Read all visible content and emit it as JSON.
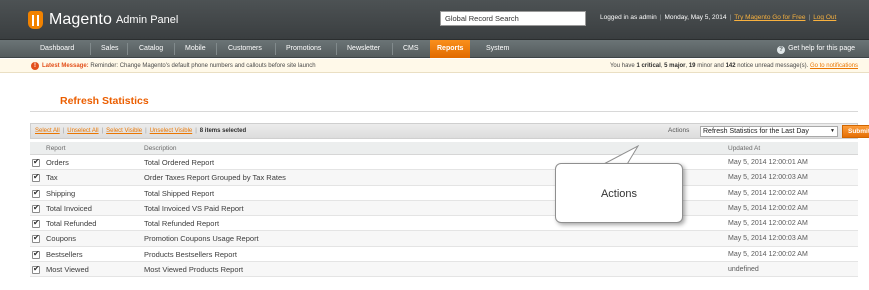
{
  "header": {
    "logo_main": "Magento",
    "logo_sub": "Admin Panel",
    "search_value": "Global Record Search",
    "logged_in": "Logged in as admin",
    "date": "Monday, May 5, 2014",
    "try_link": "Try Magento Go for Free",
    "logout": "Log Out"
  },
  "nav": {
    "items": [
      "Dashboard",
      "Sales",
      "Catalog",
      "Mobile",
      "Customers",
      "Promotions",
      "Newsletter",
      "CMS",
      "Reports",
      "System"
    ],
    "active": "Reports",
    "help": "Get help for this page"
  },
  "notice": {
    "label": "Latest Message:",
    "message": "Reminder: Change Magento's default phone numbers and callouts before site launch",
    "summary_prefix": "You have",
    "critical": "1 critical",
    "major": "5 major",
    "minor": "19",
    "minor_suffix": "minor and",
    "notice_count": "142",
    "notice_suffix": "notice unread message(s).",
    "link": "Go to notifications"
  },
  "page": {
    "title": "Refresh Statistics"
  },
  "massaction": {
    "select_all": "Select All",
    "unselect_all": "Unselect All",
    "select_visible": "Select Visible",
    "unselect_visible": "Unselect Visible",
    "selected": "8 items selected",
    "actions_label": "Actions",
    "actions_value": "Refresh Statistics for the Last Day",
    "submit": "Submit"
  },
  "grid": {
    "headers": {
      "report": "Report",
      "description": "Description",
      "updated": "Updated At"
    },
    "rows": [
      {
        "report": "Orders",
        "description": "Total Ordered Report",
        "updated": "May 5, 2014 12:00:01 AM"
      },
      {
        "report": "Tax",
        "description": "Order Taxes Report Grouped by Tax Rates",
        "updated": "May 5, 2014 12:00:03 AM"
      },
      {
        "report": "Shipping",
        "description": "Total Shipped Report",
        "updated": "May 5, 2014 12:00:02 AM"
      },
      {
        "report": "Total Invoiced",
        "description": "Total Invoiced VS Paid Report",
        "updated": "May 5, 2014 12:00:02 AM"
      },
      {
        "report": "Total Refunded",
        "description": "Total Refunded Report",
        "updated": "May 5, 2014 12:00:02 AM"
      },
      {
        "report": "Coupons",
        "description": "Promotion Coupons Usage Report",
        "updated": "May 5, 2014 12:00:03 AM"
      },
      {
        "report": "Bestsellers",
        "description": "Products Bestsellers Report",
        "updated": "May 5, 2014 12:00:02 AM"
      },
      {
        "report": "Most Viewed",
        "description": "Most Viewed Products Report",
        "updated": "undefined"
      }
    ]
  },
  "callout": {
    "text": "Actions"
  },
  "colors": {
    "accent": "#eb5e00",
    "header_bg": "#45494b",
    "nav_bg": "#5f6769",
    "active_tab": "#f07d0e"
  }
}
